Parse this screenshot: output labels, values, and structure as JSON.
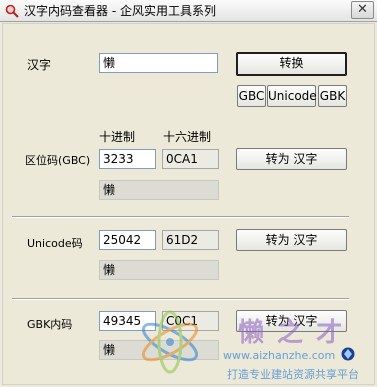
{
  "window": {
    "title": "汉字内码查看器 - 企风实用工具系列",
    "close_glyph": "✕"
  },
  "hanzi": {
    "label": "汉字",
    "value": "懒",
    "convert_button": "转换"
  },
  "encoding_buttons": [
    "GBC",
    "Unicode",
    "GBK"
  ],
  "columns": {
    "decimal": "十进制",
    "hex": "十六进制"
  },
  "quwei": {
    "label": "区位码(GBC)",
    "decimal": "3233",
    "hex": "0CA1",
    "button": "转为 汉字",
    "result": "懒"
  },
  "unicode": {
    "label": "Unicode码",
    "decimal": "25042",
    "hex": "61D2",
    "button": "转为 汉字",
    "result": "懒"
  },
  "gbk": {
    "label": "GBK内码",
    "decimal": "49345",
    "hex": "C0C1",
    "button": "转为 汉字",
    "result": "懒"
  },
  "watermark": {
    "brand": "懒 之 才",
    "url": "www.aizhanzhe.com",
    "slogan": "打造专业建站资源共享平台"
  },
  "colors": {
    "watermark_purple": "#8a5cc4",
    "watermark_blue": "#2b7fd4",
    "watermark_orange": "#e88a1e"
  }
}
